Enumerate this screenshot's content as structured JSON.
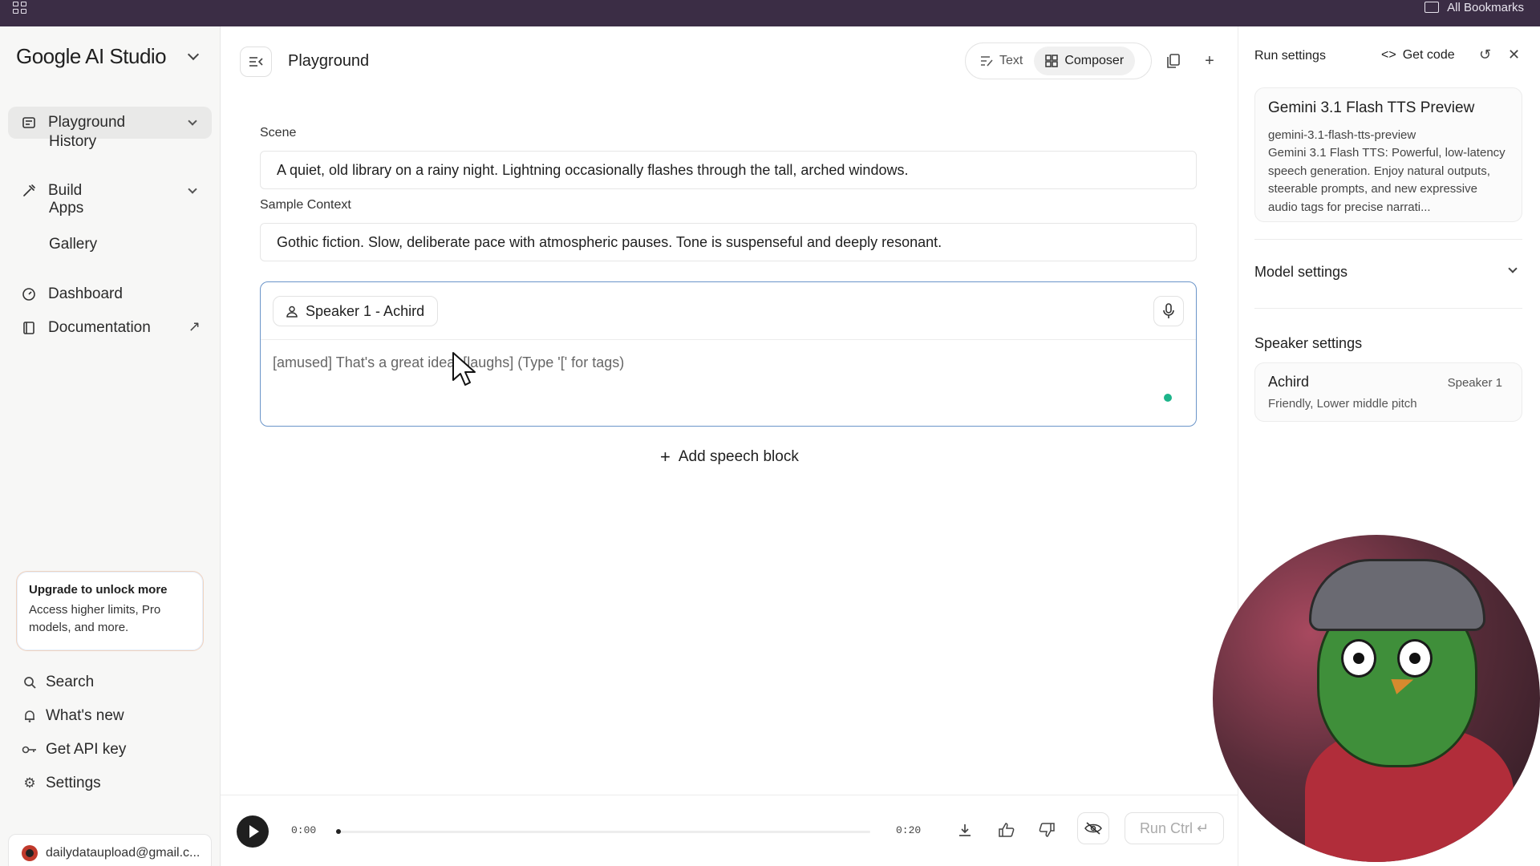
{
  "browser": {
    "bookmarks_label": "All Bookmarks"
  },
  "sidebar": {
    "brand": "Google AI Studio",
    "nav": {
      "playground": "Playground",
      "history": "History",
      "build": "Build",
      "apps": "Apps",
      "gallery": "Gallery",
      "dashboard": "Dashboard",
      "documentation": "Documentation"
    },
    "upgrade": {
      "title": "Upgrade to unlock more",
      "body": "Access higher limits, Pro models, and more."
    },
    "bottom": {
      "search": "Search",
      "whats_new": "What's new",
      "api_key": "Get API key",
      "settings": "Settings"
    },
    "account_email": "dailydataupload@gmail.c..."
  },
  "header": {
    "title": "Playground",
    "mode_text": "Text",
    "mode_composer": "Composer"
  },
  "form": {
    "scene_label": "Scene",
    "scene_value": "A quiet, old library on a rainy night. Lightning occasionally flashes through the tall, arched windows.",
    "context_label": "Sample Context",
    "context_value": "Gothic fiction. Slow, deliberate pace with atmospheric pauses. Tone is suspenseful and deeply resonant.",
    "speaker_chip": "Speaker 1 - Achird",
    "speech_placeholder": "[amused] That's a great idea! [laughs] (Type '[' for tags)",
    "add_block": "Add speech block"
  },
  "player": {
    "current_time": "0:00",
    "duration": "0:20",
    "progress": 0,
    "run_label": "Run Ctrl ↵"
  },
  "run_settings": {
    "title": "Run settings",
    "get_code": "Get code",
    "model_name": "Gemini 3.1 Flash TTS Preview",
    "model_id": "gemini-3.1-flash-tts-preview",
    "model_desc": "Gemini 3.1 Flash TTS: Powerful, low-latency speech generation. Enjoy natural outputs, steerable prompts, and new expressive audio tags for precise narrati...",
    "model_settings": "Model settings",
    "speaker_settings": "Speaker settings",
    "speaker_name": "Achird",
    "speaker_role": "Speaker 1",
    "speaker_desc": "Friendly, Lower middle pitch"
  },
  "icons": {
    "apps": "apps-grid-icon",
    "folder": "folder-icon",
    "playground": "playground-icon",
    "build": "build-icon",
    "dashboard": "dashboard-icon",
    "documentation": "book-icon",
    "external": "external-link-icon",
    "search": "search-icon",
    "bell": "bell-icon",
    "key": "key-icon",
    "gear": "gear-icon",
    "person": "person-icon",
    "mic": "microphone-icon",
    "plus": "plus-icon",
    "download": "download-icon",
    "thumbs_up": "thumbs-up-icon",
    "thumbs_down": "thumbs-down-icon",
    "eye_off": "eye-off-icon",
    "code": "code-icon",
    "reset": "reset-icon",
    "close": "close-icon"
  },
  "colors": {
    "browser_bar": "#3b2d45",
    "active_border": "#6b95c9",
    "status_dot": "#1db48a"
  }
}
